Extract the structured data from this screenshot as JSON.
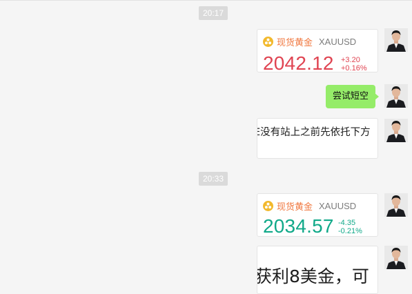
{
  "chat": {
    "messages": [
      {
        "type": "timestamp",
        "text": "20:17"
      },
      {
        "type": "quote_card",
        "name": "现货黄金",
        "symbol": "XAUUSD",
        "price": "2042.12",
        "change": "+3.20",
        "change_pct": "+0.16%",
        "direction": "up"
      },
      {
        "type": "text_bubble",
        "text": "尝试短空"
      },
      {
        "type": "image",
        "visible_text": "E没有站上之前先依托下方"
      },
      {
        "type": "timestamp",
        "text": "20:33"
      },
      {
        "type": "quote_card",
        "name": "现货黄金",
        "symbol": "XAUUSD",
        "price": "2034.57",
        "change": "-4.35",
        "change_pct": "-0.21%",
        "direction": "down"
      },
      {
        "type": "image",
        "visible_text": "获利8美金，可"
      }
    ]
  },
  "icons": {
    "quote": "gold-coins-icon",
    "avatar": "user-avatar-photo"
  },
  "colors": {
    "background": "#f5f5f5",
    "bubble": "#95ec69",
    "up": "#e04452",
    "down": "#10a989",
    "quote_name": "#f0773e",
    "gold_icon": "#f2b92d"
  }
}
